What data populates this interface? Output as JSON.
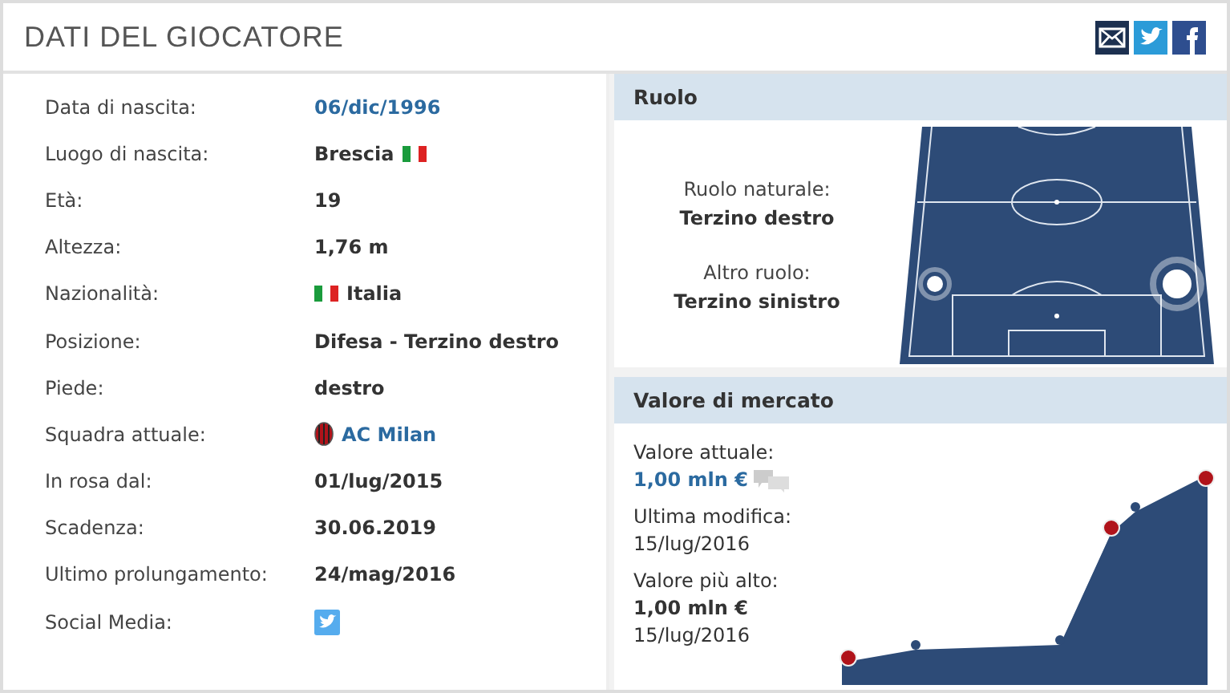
{
  "header": {
    "title": "DATI DEL GIOCATORE"
  },
  "details": [
    {
      "label": "Data di nascita:",
      "value": "06/dic/1996",
      "kind": "link"
    },
    {
      "label": "Luogo di nascita:",
      "value": "Brescia",
      "kind": "flag-after"
    },
    {
      "label": "Età:",
      "value": "19",
      "kind": "text"
    },
    {
      "label": "Altezza:",
      "value": "1,76 m",
      "kind": "text"
    },
    {
      "label": "Nazionalità:",
      "value": "Italia",
      "kind": "flag-before"
    },
    {
      "label": "Posizione:",
      "value": "Difesa - Terzino destro",
      "kind": "text"
    },
    {
      "label": "Piede:",
      "value": "destro",
      "kind": "text"
    },
    {
      "label": "Squadra attuale:",
      "value": "AC Milan",
      "kind": "club"
    },
    {
      "label": "In rosa dal:",
      "value": "01/lug/2015",
      "kind": "text"
    },
    {
      "label": "Scadenza:",
      "value": "30.06.2019",
      "kind": "text"
    },
    {
      "label": "Ultimo prolungamento:",
      "value": "24/mag/2016",
      "kind": "text"
    },
    {
      "label": "Social Media:",
      "kind": "twitter"
    }
  ],
  "role": {
    "title": "Ruolo",
    "natural_label": "Ruolo naturale:",
    "natural_value": "Terzino destro",
    "other_label": "Altro ruolo:",
    "other_value": "Terzino sinistro"
  },
  "market": {
    "title": "Valore di mercato",
    "current_label": "Valore attuale:",
    "current_value": "1,00 mln €",
    "modified_label": "Ultima modifica:",
    "modified_value": "15/lug/2016",
    "highest_label": "Valore più alto:",
    "highest_value": "1,00 mln €",
    "highest_date": "15/lug/2016"
  }
}
